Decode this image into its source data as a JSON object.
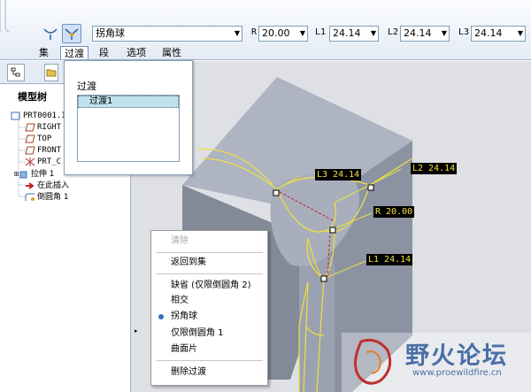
{
  "toolbar": {
    "transition_type": "拐角球",
    "r_label": "R",
    "r_value": "20.00",
    "l1_label": "L1",
    "l1_value": "24.14",
    "l2_label": "L2",
    "l2_value": "24.14",
    "l3_label": "L3",
    "l3_value": "24.14"
  },
  "tabs": [
    "集",
    "过渡",
    "段",
    "选项",
    "属性"
  ],
  "popup": {
    "title": "过渡",
    "items": [
      "过渡1"
    ]
  },
  "model_tree": {
    "title": "模型树",
    "items": [
      {
        "label": "PRT0001.I",
        "icon": "part-icon"
      },
      {
        "label": "RIGHT",
        "icon": "datum-plane-icon"
      },
      {
        "label": "TOP",
        "icon": "datum-plane-icon"
      },
      {
        "label": "FRONT",
        "icon": "datum-plane-icon"
      },
      {
        "label": "PRT_C",
        "icon": "coordinate-system-icon"
      },
      {
        "label": "拉伸 1",
        "icon": "extrude-icon"
      },
      {
        "label": "在此插入",
        "icon": "insert-here-arrow-icon"
      },
      {
        "label": "倒圆角 1",
        "icon": "round-icon"
      }
    ]
  },
  "context_menu": {
    "items": [
      {
        "label": "清除",
        "disabled": true
      },
      {
        "label": "返回到集",
        "disabled": false
      },
      {
        "label": "缺省 (仅限倒圆角 2)",
        "disabled": false
      },
      {
        "label": "相交",
        "disabled": false
      },
      {
        "label": "拐角球",
        "disabled": false,
        "selected": true
      },
      {
        "label": "仅限倒圆角 1",
        "disabled": false
      },
      {
        "label": "曲面片",
        "disabled": false
      },
      {
        "label": "删除过渡",
        "disabled": false
      }
    ]
  },
  "dimensions": {
    "l3": "L3 24.14",
    "l2": "L2 24.14",
    "r": "R 20.00",
    "l1": "L1 24.14"
  },
  "watermark": {
    "text": "野火论坛",
    "url": "www.proewildfire.cn"
  },
  "colors": {
    "accent": "#6f8fbf",
    "highlight_edge": "#f0e040",
    "dimension_bg": "#000000",
    "selected_item": "#bde3ec"
  }
}
